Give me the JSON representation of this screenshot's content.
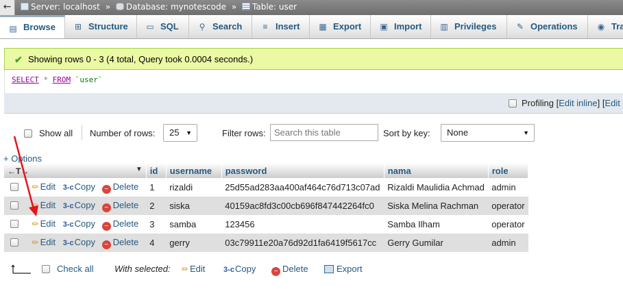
{
  "breadcrumb": {
    "back_icon": "back-arrow-icon",
    "server": "Server: localhost",
    "database": "Database: mynotescode",
    "table": "Table: user",
    "separator": "»"
  },
  "tabs": [
    {
      "label": "Browse",
      "icon": "browse-icon",
      "active": true
    },
    {
      "label": "Structure",
      "icon": "structure-icon"
    },
    {
      "label": "SQL",
      "icon": "sql-icon"
    },
    {
      "label": "Search",
      "icon": "search-icon"
    },
    {
      "label": "Insert",
      "icon": "insert-icon"
    },
    {
      "label": "Export",
      "icon": "export-icon"
    },
    {
      "label": "Import",
      "icon": "import-icon"
    },
    {
      "label": "Privileges",
      "icon": "privileges-icon"
    },
    {
      "label": "Operations",
      "icon": "operations-icon"
    },
    {
      "label": "Tra",
      "icon": "tracking-icon"
    }
  ],
  "message": {
    "text": "Showing rows 0 - 3 (4 total, Query took 0.0004 seconds.)",
    "color": "#ebf8a4"
  },
  "query": {
    "select": "SELECT",
    "star": "*",
    "from": "FROM",
    "table": "`user`"
  },
  "profiling": {
    "label": "Profiling",
    "open_bracket": "[",
    "edit_inline": "Edit inline",
    "mid": "] [",
    "edit": "Edit"
  },
  "nav": {
    "show_all": "Show all",
    "num_rows_label": "Number of rows:",
    "num_rows_value": "25",
    "filter_label": "Filter rows:",
    "filter_placeholder": "Search this table",
    "sort_label": "Sort by key:",
    "sort_value": "None"
  },
  "options_link": "+ Options",
  "table": {
    "headers": [
      "id",
      "username",
      "password",
      "nama",
      "role"
    ],
    "actions": {
      "edit": "Edit",
      "copy": "Copy",
      "delete": "Delete"
    },
    "rows": [
      {
        "id": "1",
        "username": "rizaldi",
        "password": "25d55ad283aa400af464c76d713c07ad",
        "nama": "Rizaldi Maulidia Achmad",
        "role": "admin"
      },
      {
        "id": "2",
        "username": "siska",
        "password": "40159ac8fd3c00cb696f847442264fc0",
        "nama": "Siska Melina Rachman",
        "role": "operator"
      },
      {
        "id": "3",
        "username": "samba",
        "password": "123456",
        "nama": "Samba Ilham",
        "role": "operator"
      },
      {
        "id": "4",
        "username": "gerry",
        "password": "03c79911e20a76d92d1fa6419f5617cc",
        "nama": "Gerry Gumilar",
        "role": "admin"
      }
    ]
  },
  "bottom": {
    "check_all": "Check all",
    "with_selected": "With selected:",
    "edit": "Edit",
    "copy": "Copy",
    "delete": "Delete",
    "export": "Export"
  },
  "colors": {
    "link": "#235a81",
    "row_alt": "#dfdfdf",
    "annotation_arrow": "#e3141c"
  }
}
